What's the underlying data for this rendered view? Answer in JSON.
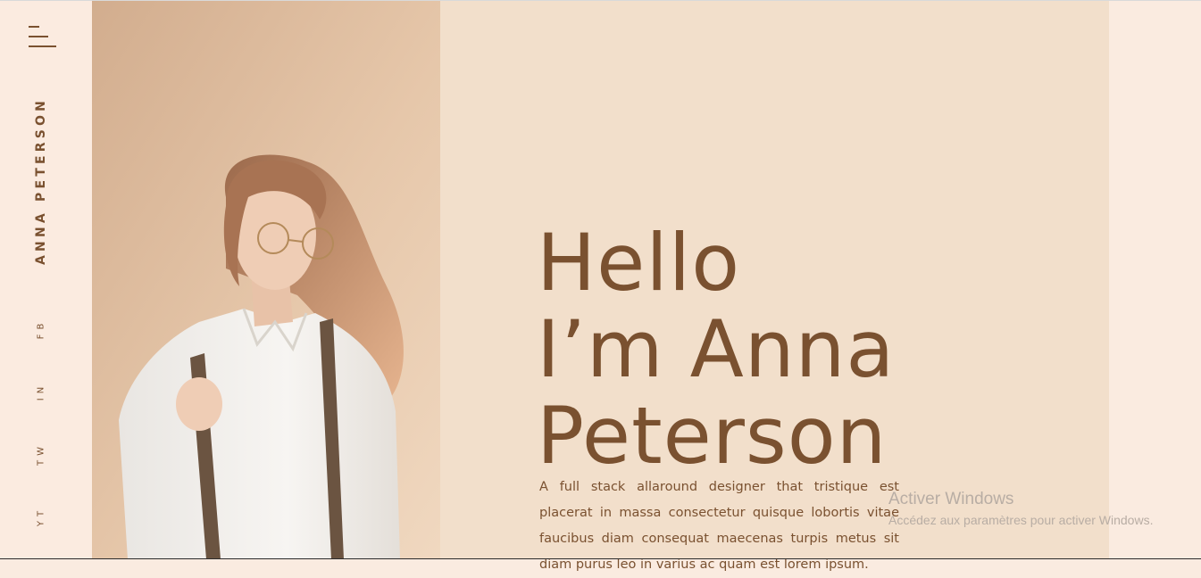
{
  "sidebar": {
    "brand_name": "ANNA PETERSON",
    "menu_icon": "hamburger-menu-icon",
    "social_links": [
      "FB",
      "IN",
      "TW",
      "YT"
    ]
  },
  "hero": {
    "headline_lines": [
      "Hello",
      "I’m Anna",
      "Peterson"
    ],
    "description": "A full stack allaround designer that tristique est placerat in massa consectetur quisque lobortis vitae faucibus diam consequat maecenas turpis metus sit diam purus leo in varius ac quam est lorem ipsum.",
    "photo_alt": "portrait-photo"
  },
  "windows_watermark": {
    "title": "Activer Windows",
    "subtitle": "Accédez aux paramètres pour activer Windows."
  },
  "colors": {
    "accent_brown": "#7a5130",
    "content_bg": "#f2dfcb",
    "page_bg": "#faebe0"
  }
}
